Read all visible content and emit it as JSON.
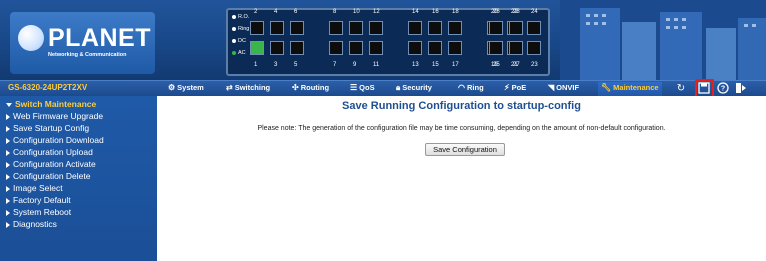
{
  "brand": {
    "name": "PLANET",
    "tagline": "Networking & Communication"
  },
  "leds": [
    {
      "label": "R.O."
    },
    {
      "label": "Ring"
    },
    {
      "label": "DC"
    },
    {
      "label": "AC"
    }
  ],
  "ports": {
    "top_numbers": [
      "2",
      "4",
      "6",
      "8",
      "10",
      "12",
      "14",
      "16",
      "18",
      "20",
      "22",
      "24",
      "26",
      "28"
    ],
    "bottom_numbers": [
      "1",
      "3",
      "5",
      "7",
      "9",
      "11",
      "13",
      "15",
      "17",
      "19",
      "21",
      "23",
      "25",
      "27"
    ]
  },
  "model": "GS-6320-24UP2T2XV",
  "nav": {
    "items": [
      {
        "label": "System",
        "icon": "gear-icon"
      },
      {
        "label": "Switching",
        "icon": "switching-icon"
      },
      {
        "label": "Routing",
        "icon": "routing-icon"
      },
      {
        "label": "QoS",
        "icon": "qos-icon"
      },
      {
        "label": "Security",
        "icon": "lock-icon"
      },
      {
        "label": "Ring",
        "icon": "ring-icon"
      },
      {
        "label": "PoE",
        "icon": "poe-icon"
      },
      {
        "label": "ONVIF",
        "icon": "onvif-icon"
      }
    ],
    "active": {
      "label": "Maintenance",
      "icon": "wrench-icon"
    },
    "utilities": [
      {
        "name": "refresh-icon"
      },
      {
        "name": "save-icon"
      },
      {
        "name": "help-icon"
      },
      {
        "name": "logout-icon"
      }
    ]
  },
  "sidebar": {
    "title": "Switch Maintenance",
    "items": [
      "Web Firmware Upgrade",
      "Save Startup Config",
      "Configuration Download",
      "Configuration Upload",
      "Configuration Activate",
      "Configuration Delete",
      "Image Select",
      "Factory Default",
      "System Reboot",
      "Diagnostics"
    ]
  },
  "main": {
    "title": "Save Running Configuration to startup-config",
    "note": "Please note: The generation of the configuration file may be time consuming, depending on the amount of non-default configuration.",
    "button_label": "Save Configuration"
  },
  "colors": {
    "header_blue": "#1a4a8c",
    "accent_yellow": "#ffcc33",
    "highlight_red": "#e8201a",
    "port_active_green": "#39b54a"
  }
}
